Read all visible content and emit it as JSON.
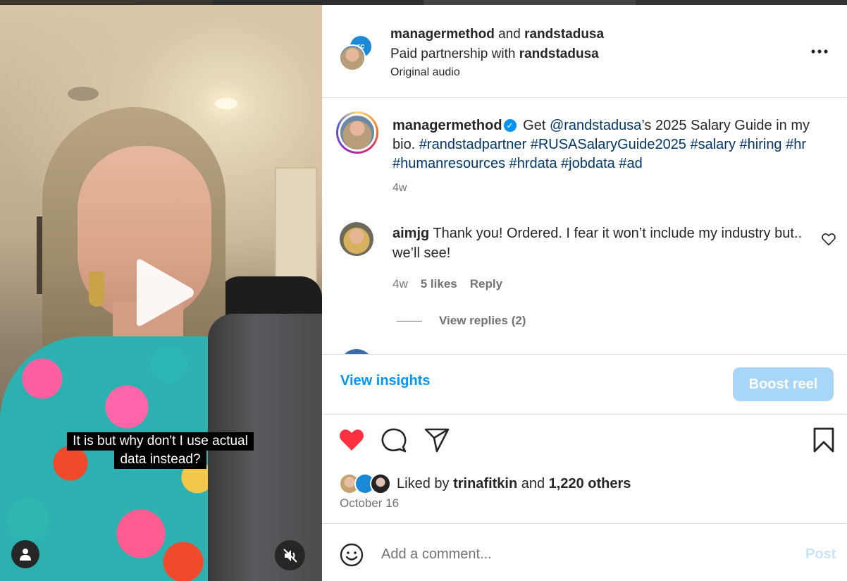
{
  "video": {
    "caption_line1": "It is but why don't I use actual",
    "caption_line2": "data instead?"
  },
  "header": {
    "collab_user1": "managermethod",
    "and_text": " and ",
    "collab_user2": "randstadusa",
    "paid_prefix": "Paid partnership with ",
    "paid_partner": "randstadusa",
    "audio": "Original audio",
    "more_icon": "more-icon"
  },
  "post_caption": {
    "user": "managermethod",
    "text_prefix": " Get ",
    "mention": "@randstadusa",
    "text_mid": "’s 2025 Salary Guide in my bio. ",
    "hashtags": "#randstadpartner #RUSASalaryGuide2025 #salary #hiring #hr #humanresources #hrdata #jobdata #ad",
    "time": "4w"
  },
  "comments": [
    {
      "user": "aimjg",
      "text": " Thank you! Ordered. I fear it won’t include my industry but.. we’ll see!",
      "time": "4w",
      "likes": "5 likes",
      "reply": "Reply",
      "view_replies": "View replies (2)"
    }
  ],
  "insights": {
    "view_insights": "View insights",
    "boost": "Boost reel"
  },
  "likes": {
    "prefix": "Liked by ",
    "user": "trinafitkin",
    "and": " and ",
    "others": "1,220 others",
    "date": "October 16"
  },
  "comment_box": {
    "placeholder": "Add a comment...",
    "post": "Post"
  },
  "colors": {
    "accent": "#0095f6",
    "like_red": "#ff3040",
    "link": "#00376b"
  }
}
